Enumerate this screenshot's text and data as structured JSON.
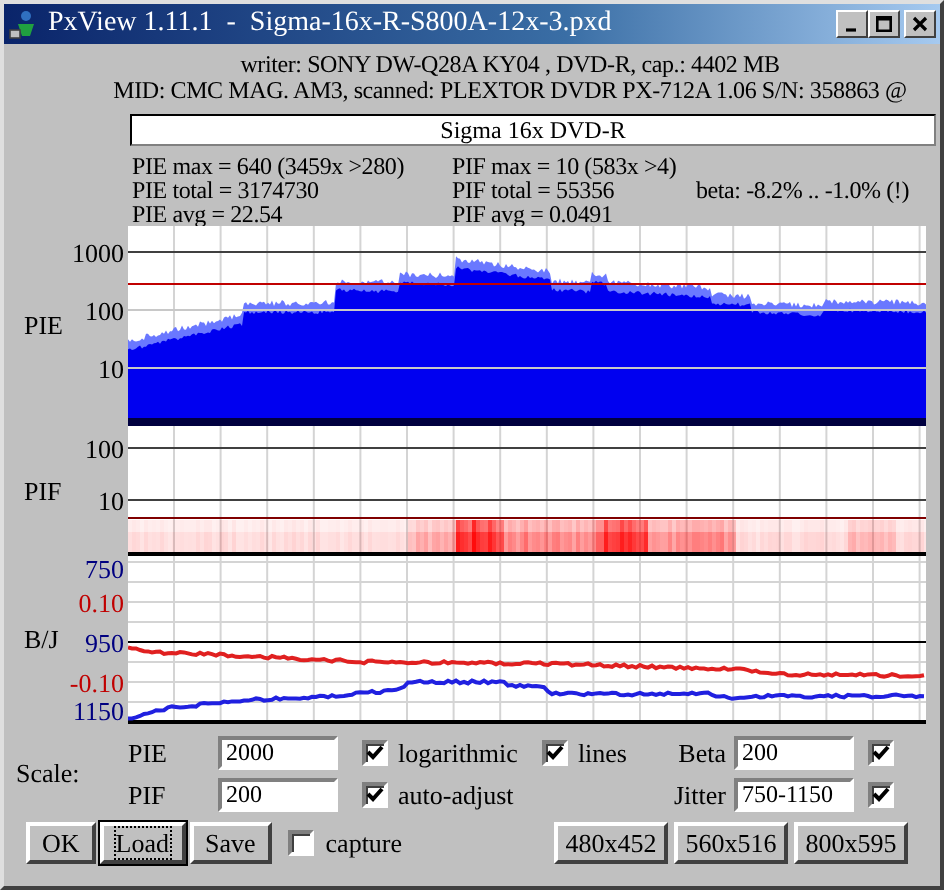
{
  "window": {
    "title": "PxView 1.11.1  -  Sigma-16x-R-S800A-12x-3.pxd"
  },
  "info": {
    "lines": [
      "writer: SONY DW-Q28A KY04 , DVD-R, cap.: 4402 MB",
      "MID: CMC MAG. AM3, scanned: PLEXTOR DVDR PX-712A 1.06 S/N: 358863 @"
    ]
  },
  "disc_label": {
    "value": "Sigma 16x DVD-R"
  },
  "stats": {
    "pie": [
      "PIE max = 640 (3459x >280)",
      "PIE total = 3174730",
      "PIE avg = 22.54"
    ],
    "pif": [
      "PIF max = 10 (583x >4)",
      "PIF total = 55356",
      "PIF avg = 0.0491"
    ],
    "beta": "beta: -8.2% .. -1.0% (!)"
  },
  "graphs": [
    {
      "kind": "pie",
      "label": "PIE",
      "ticks": [
        {
          "text": "1000"
        },
        {
          "text": "100"
        },
        {
          "text": "10"
        }
      ]
    },
    {
      "kind": "pif",
      "label": "PIF",
      "ticks": [
        {
          "text": "100"
        },
        {
          "text": "10"
        }
      ]
    },
    {
      "kind": "bj",
      "label": "B/J",
      "ticks": [
        {
          "text": "750",
          "color": "#000080"
        },
        {
          "text": "0.10",
          "color": "#c00000"
        },
        {
          "text": "950",
          "color": "#000080"
        },
        {
          "text": "-0.10",
          "color": "#c00000"
        },
        {
          "text": "1150",
          "color": "#000080"
        }
      ]
    }
  ],
  "scale": {
    "label": "Scale:",
    "rows": [
      {
        "label": "PIE",
        "value": "2000",
        "options": [
          {
            "label": "logarithmic",
            "checked": true
          },
          {
            "label": "lines",
            "checked": true
          }
        ],
        "right": {
          "label": "Beta",
          "value": "200",
          "checked": true
        }
      },
      {
        "label": "PIF",
        "value": "200",
        "options": [
          {
            "label": "auto-adjust",
            "checked": true
          }
        ],
        "right": {
          "label": "Jitter",
          "value": "750-1150",
          "checked": true
        }
      }
    ]
  },
  "buttons": [
    {
      "label": "OK",
      "focused": false
    },
    {
      "label": "Load",
      "focused": true
    },
    {
      "label": "Save",
      "focused": false
    }
  ],
  "capture": {
    "label": "capture",
    "checked": false
  },
  "size_buttons": [
    "480x452",
    "560x516",
    "800x595"
  ]
}
